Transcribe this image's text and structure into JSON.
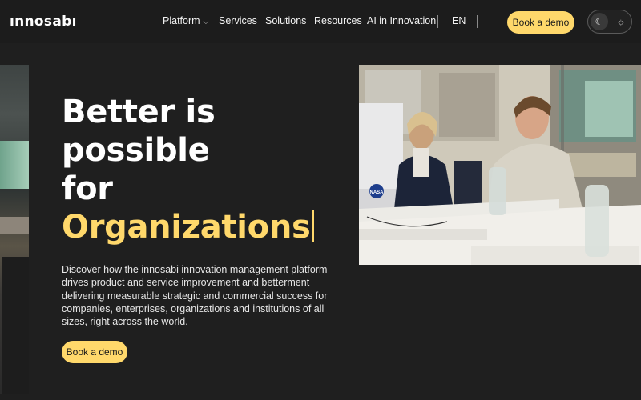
{
  "header": {
    "logo": "ınnosabı",
    "nav": {
      "platform": "Platform",
      "services": "Services",
      "solutions": "Solutions",
      "resources": "Resources",
      "ai": "AI in Innovation",
      "lang": "EN"
    },
    "cta": "Book a demo",
    "theme": {
      "dark_icon": "☾",
      "light_icon": "☼"
    }
  },
  "hero": {
    "title_line1": "Better is possible",
    "title_prefix": "for ",
    "title_accent": "Organizations",
    "description": "Discover how the innosabi innovation management platform drives product and service improvement and betterment delivering measurable strategic and commercial success for companies, enterprises, organizations and institutions of all sizes, right across the world.",
    "cta": "Book a demo"
  },
  "photo": {
    "sticker_label": "NASA"
  },
  "colors": {
    "accent": "#ffd86b",
    "background": "#1f1f1f"
  }
}
